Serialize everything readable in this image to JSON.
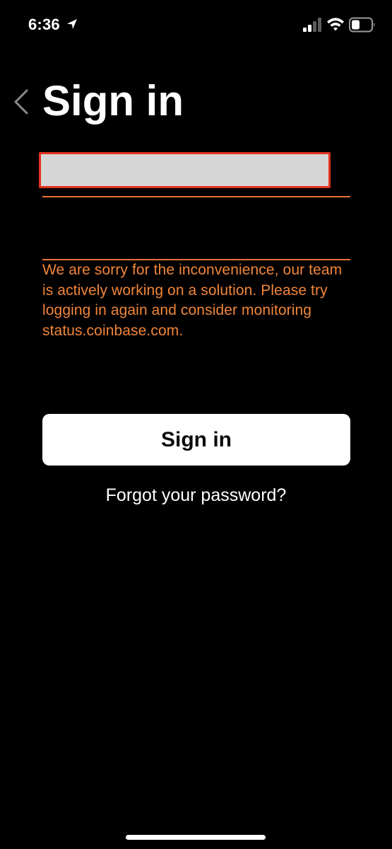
{
  "status_bar": {
    "time": "6:36",
    "location_icon": "location-arrow-icon",
    "signal_icon": "cellular-signal-icon",
    "wifi_icon": "wifi-icon",
    "battery_icon": "battery-icon"
  },
  "header": {
    "back_icon": "chevron-left-icon",
    "title": "Sign in"
  },
  "form": {
    "email_value": "",
    "email_placeholder": "",
    "password_value": "",
    "password_placeholder": "",
    "error_message": "We are sorry for the inconvenience, our team is actively working on a solution. Please try logging in again and consider monitoring status.coinbase.com.",
    "submit_label": "Sign in",
    "forgot_password_label": "Forgot your password?"
  },
  "colors": {
    "background": "#000000",
    "error": "#f0853a",
    "field_underline": "#e8713a",
    "input_border": "#e1321e",
    "button_bg": "#ffffff",
    "button_text": "#0a0b0d"
  }
}
